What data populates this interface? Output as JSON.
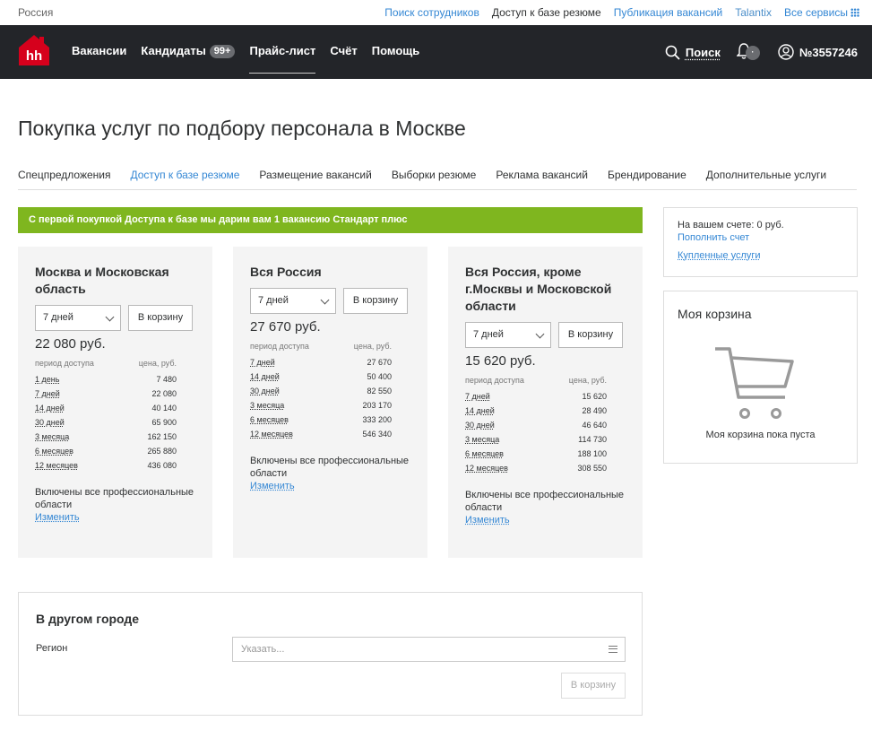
{
  "topbar": {
    "country": "Россия",
    "links": [
      {
        "label": "Поиск сотрудников"
      },
      {
        "label": "Доступ к базе резюме"
      },
      {
        "label": "Публикация вакансий"
      },
      {
        "label": "Talantix"
      },
      {
        "label": "Все сервисы"
      }
    ]
  },
  "header": {
    "logo_text": "hh",
    "nav": [
      "Вакансии",
      "Кандидаты",
      "Прайс-лист",
      "Счёт",
      "Помощь"
    ],
    "candidates_badge": "99+",
    "search_label": "Поиск",
    "notification_count": "·",
    "account_number": "№3557246"
  },
  "page": {
    "title": "Покупка услуг по подбору персонала в Москве",
    "tabs": [
      "Спецпредложения",
      "Доступ к базе резюме",
      "Размещение вакансий",
      "Выборки резюме",
      "Реклама вакансий",
      "Брендирование",
      "Дополнительные услуги"
    ],
    "promo": "С первой покупкой Доступа к базе мы дарим вам 1 вакансию Стандарт плюс"
  },
  "common": {
    "period_header": "период доступа",
    "price_header": "цена, руб.",
    "add_to_cart": "В корзину",
    "included_note": "Включены все профессиональные области",
    "change_link": "Изменить"
  },
  "cards": [
    {
      "title": "Москва и Московская область",
      "selected_period": "7 дней",
      "price": "22 080 руб.",
      "rows": [
        {
          "period": "1 день",
          "price": "7 480"
        },
        {
          "period": "7 дней",
          "price": "22 080"
        },
        {
          "period": "14 дней",
          "price": "40 140"
        },
        {
          "period": "30 дней",
          "price": "65 900"
        },
        {
          "period": "3 месяца",
          "price": "162 150"
        },
        {
          "period": "6 месяцев",
          "price": "265 880"
        },
        {
          "period": "12 месяцев",
          "price": "436 080"
        }
      ]
    },
    {
      "title": "Вся Россия",
      "selected_period": "7 дней",
      "price": "27 670 руб.",
      "rows": [
        {
          "period": "7 дней",
          "price": "27 670"
        },
        {
          "period": "14 дней",
          "price": "50 400"
        },
        {
          "period": "30 дней",
          "price": "82 550"
        },
        {
          "period": "3 месяца",
          "price": "203 170"
        },
        {
          "period": "6 месяцев",
          "price": "333 200"
        },
        {
          "period": "12 месяцев",
          "price": "546 340"
        }
      ]
    },
    {
      "title": "Вся Россия, кроме г.Москвы и Московской области",
      "selected_period": "7 дней",
      "price": "15 620 руб.",
      "rows": [
        {
          "period": "7 дней",
          "price": "15 620"
        },
        {
          "period": "14 дней",
          "price": "28 490"
        },
        {
          "period": "30 дней",
          "price": "46 640"
        },
        {
          "period": "3 месяца",
          "price": "114 730"
        },
        {
          "period": "6 месяцев",
          "price": "188 100"
        },
        {
          "period": "12 месяцев",
          "price": "308 550"
        }
      ]
    }
  ],
  "other_city": {
    "title": "В другом городе",
    "region_label": "Регион",
    "region_placeholder": "Указать..."
  },
  "sidebar": {
    "balance": "На вашем счете: 0 руб.",
    "top_up": "Пополнить счет",
    "purchased": "Купленные услуги",
    "cart_title": "Моя корзина",
    "cart_empty": "Моя корзина пока пуста"
  },
  "colors": {
    "accent_blue": "#3487d4",
    "promo_green": "#7fb61f",
    "header_bg": "#232529",
    "logo_red": "#d6001c"
  }
}
